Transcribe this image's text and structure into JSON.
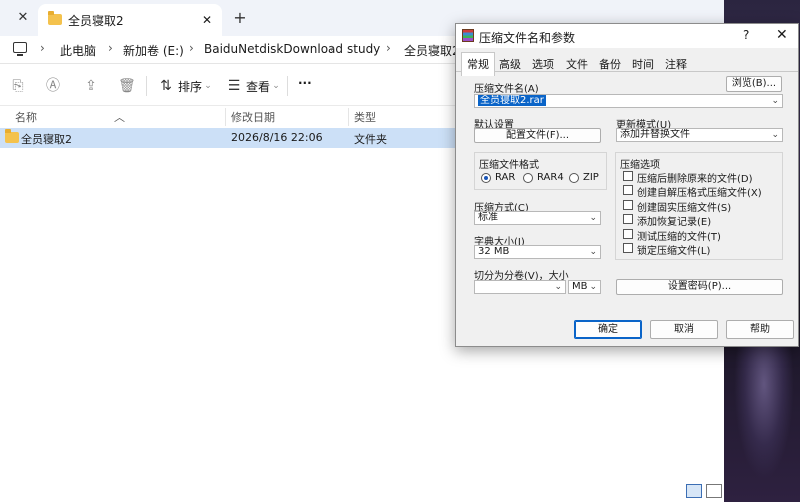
{
  "explorer": {
    "tab_title": "全员寝取2",
    "close_glyph": "✕",
    "tab_close_glyph": "✕",
    "new_tab_glyph": "+",
    "breadcrumb": [
      "此电脑",
      "新加卷 (E:)",
      "BaiduNetdiskDownload",
      "study",
      "全员寝取2"
    ],
    "breadcrumb_sep": "›",
    "toolbar": {
      "sort_label": "排序",
      "view_label": "查看",
      "more_glyph": "···"
    },
    "columns": {
      "name": "名称",
      "modified": "修改日期",
      "type": "类型"
    },
    "rows": [
      {
        "name": "全员寝取2",
        "modified": "2026/8/16 22:06",
        "type": "文件夹"
      }
    ]
  },
  "dialog": {
    "title": "压缩文件名和参数",
    "help_glyph": "?",
    "close_glyph": "✕",
    "tabs": [
      "常规",
      "高级",
      "选项",
      "文件",
      "备份",
      "时间",
      "注释"
    ],
    "active_tab": "常规",
    "archive_name_label": "压缩文件名(A)",
    "archive_name_value": "全员寝取2.rar",
    "browse_label": "浏览(B)...",
    "default_settings_label": "默认设置",
    "profiles_label": "配置文件(F)...",
    "update_mode_label": "更新模式(U)",
    "update_mode_value": "添加并替换文件",
    "format_label": "压缩文件格式",
    "formats": [
      "RAR",
      "RAR4",
      "ZIP"
    ],
    "selected_format": "RAR",
    "method_label": "压缩方式(C)",
    "method_value": "标准",
    "dict_label": "字典大小(I)",
    "dict_value": "32 MB",
    "split_label": "切分为分卷(V)，大小",
    "split_value": "",
    "split_unit": "MB",
    "options_label": "压缩选项",
    "options": [
      {
        "label": "压缩后删除原来的文件(D)",
        "checked": false
      },
      {
        "label": "创建自解压格式压缩文件(X)",
        "checked": false
      },
      {
        "label": "创建固实压缩文件(S)",
        "checked": false
      },
      {
        "label": "添加恢复记录(E)",
        "checked": false
      },
      {
        "label": "测试压缩的文件(T)",
        "checked": false
      },
      {
        "label": "锁定压缩文件(L)",
        "checked": false
      }
    ],
    "set_password_label": "设置密码(P)...",
    "ok_label": "确定",
    "cancel_label": "取消",
    "help_label": "帮助"
  },
  "colors": {
    "accent": "#0a64c8",
    "selection": "#cce0f7",
    "folder": "#f4c24d"
  }
}
